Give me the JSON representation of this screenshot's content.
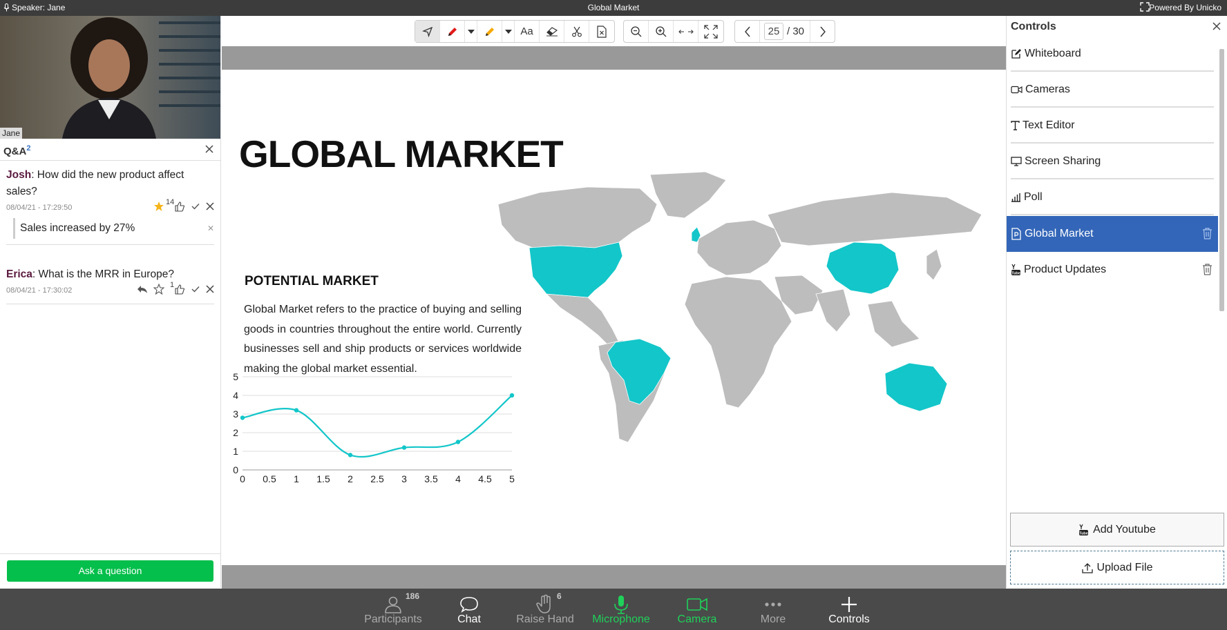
{
  "topbar": {
    "speaker": "Speaker: Jane",
    "title": "Global Market",
    "powered": "Powered By Unicko"
  },
  "video": {
    "name": "Jane"
  },
  "qa": {
    "title": "Q&A",
    "count": "2",
    "questions": [
      {
        "author": "Josh",
        "text": ": How did the new product affect sales?",
        "time": "08/04/21 - 17:29:50",
        "likes": "14",
        "answer": "Sales increased by 27%"
      },
      {
        "author": "Erica",
        "text": ": What is the MRR in Europe?",
        "time": "08/04/21 - 17:30:02",
        "likes": "1"
      }
    ],
    "ask_label": "Ask a question"
  },
  "toolbar": {
    "text_tool": "Aa",
    "page_current": "25",
    "page_total": "/ 30"
  },
  "slide": {
    "title": "GLOBAL MARKET",
    "subtitle": "POTENTIAL MARKET",
    "paragraph": "Global Market refers to the practice of buying and selling goods in countries throughout the entire world. Currently businesses sell and ship products or services worldwide making the global market essential.",
    "highlight_color": "#13c6c9"
  },
  "chart_data": {
    "type": "line",
    "x": [
      0,
      1,
      2,
      3,
      4,
      5
    ],
    "values": [
      2.8,
      3.2,
      0.8,
      1.2,
      1.5,
      4.0
    ],
    "xticks": [
      "0",
      "0.5",
      "1",
      "1.5",
      "2",
      "2.5",
      "3",
      "3.5",
      "4",
      "4.5",
      "5"
    ],
    "yticks": [
      "0",
      "1",
      "2",
      "3",
      "4",
      "5"
    ],
    "xlim": [
      0,
      5
    ],
    "ylim": [
      0,
      5
    ],
    "grid": true,
    "color": "#13c6c9"
  },
  "controls": {
    "title": "Controls",
    "items": [
      {
        "label": "Whiteboard",
        "icon": "edit-icon"
      },
      {
        "label": "Cameras",
        "icon": "video-camera-icon"
      },
      {
        "label": "Text Editor",
        "icon": "text-icon"
      },
      {
        "label": "Screen Sharing",
        "icon": "monitor-icon"
      },
      {
        "label": "Poll",
        "icon": "bar-chart-icon"
      },
      {
        "label": "Global Market",
        "icon": "document-icon"
      },
      {
        "label": "Product Updates",
        "icon": "youtube-icon"
      }
    ],
    "add_youtube": "Add Youtube",
    "upload_file": "Upload File",
    "selected_color": "#3366b8"
  },
  "bottombar": {
    "participants": "Participants",
    "participants_count": "186",
    "chat": "Chat",
    "raise_hand": "Raise Hand",
    "raise_hand_count": "6",
    "microphone": "Microphone",
    "camera": "Camera",
    "more": "More",
    "controls": "Controls"
  }
}
